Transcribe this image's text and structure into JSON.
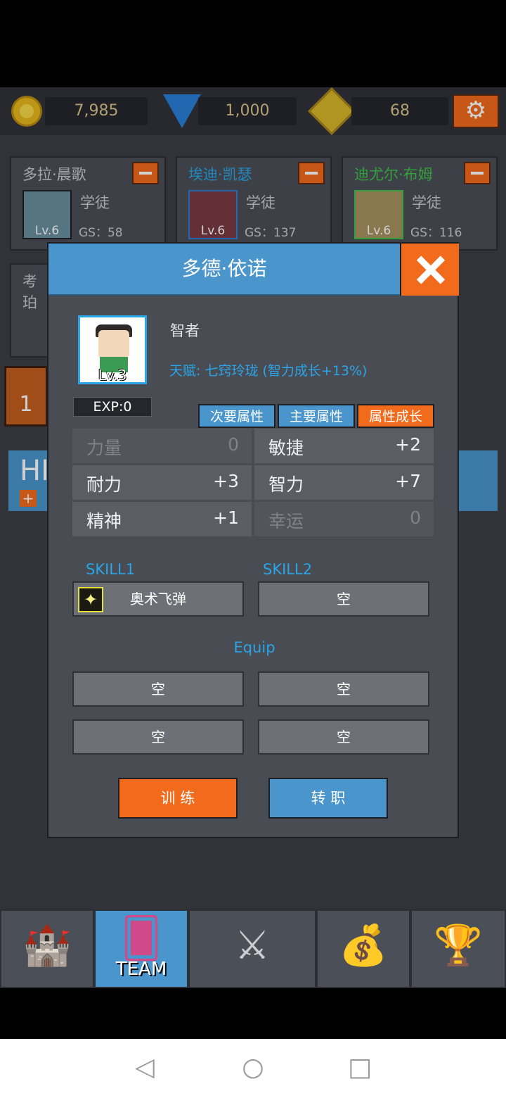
{
  "resources": {
    "gold": "7,985",
    "diamond": "1,000",
    "medal": "68"
  },
  "hero_cards": [
    {
      "name": "多拉·晨歌",
      "class": "学徒",
      "level": "Lv.6",
      "gs": "GS：58",
      "name_color": "#c9ccd1",
      "frame_color": "#1e2024"
    },
    {
      "name": "埃迪·凯瑟",
      "class": "学徒",
      "level": "Lv.6",
      "gs": "GS：137",
      "name_color": "#2aa5e8",
      "frame_color": "#2a7fd8"
    },
    {
      "name": "迪尤尔·布姆",
      "class": "学徒",
      "level": "Lv.6",
      "gs": "GS：116",
      "name_color": "#3fc14a",
      "frame_color": "#3fc14a"
    }
  ],
  "behind": {
    "partial_name": "考珀",
    "floor_number": "1",
    "hp_label": "HI"
  },
  "modal": {
    "title": "多德·依诺",
    "level": "Lv.3",
    "job": "智者",
    "talent": "天赋: 七窍玲珑 (智力成长+13%)",
    "exp": "EXP:0",
    "tabs": [
      "次要属性",
      "主要属性",
      "属性成长"
    ],
    "active_tab": "属性成长",
    "stats": [
      {
        "label": "力量",
        "value": "0"
      },
      {
        "label": "敏捷",
        "value": "+2"
      },
      {
        "label": "耐力",
        "value": "+3"
      },
      {
        "label": "智力",
        "value": "+7"
      },
      {
        "label": "精神",
        "value": "+1"
      },
      {
        "label": "幸运",
        "value": "0"
      }
    ],
    "skill1_label": "SKILL1",
    "skill2_label": "SKILL2",
    "skill1": "奥术飞弹",
    "skill2": "空",
    "equip_label": "Equip",
    "equip": [
      "空",
      "空",
      "空",
      "空"
    ],
    "train_button": "训 练",
    "job_change_button": "转 职"
  },
  "bottom_nav": {
    "items": [
      "castle-icon",
      "team-icon",
      "battle-icon",
      "bag-icon",
      "trophy-icon"
    ],
    "team_label": "TEAM",
    "active": "team"
  },
  "colors": {
    "accent_orange": "#f26b1d",
    "accent_blue": "#4a95cc",
    "talent_text": "#2aa5e8"
  }
}
